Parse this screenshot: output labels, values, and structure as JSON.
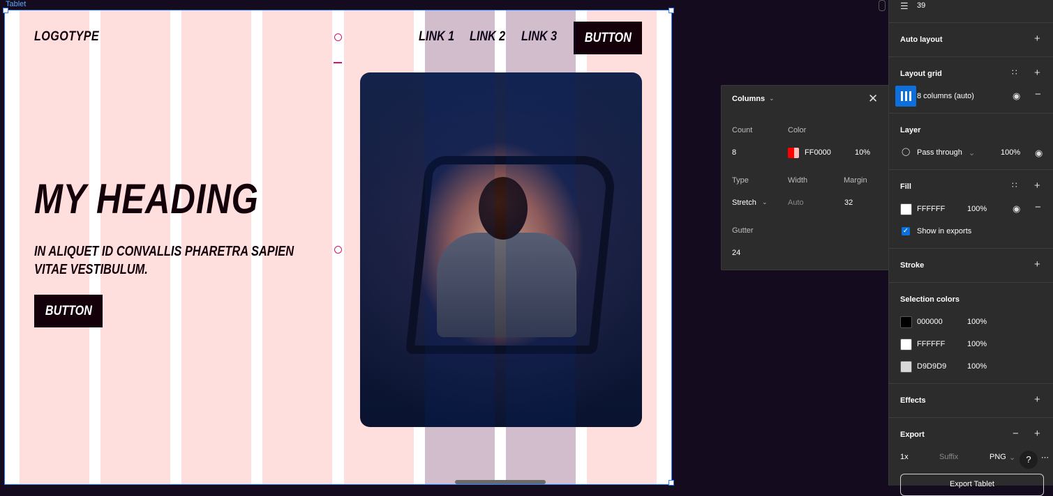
{
  "frame": {
    "label": "Tablet"
  },
  "site": {
    "logo": "LOGOTYPE",
    "links": [
      "LINK 1",
      "LINK 2",
      "LINK 3"
    ],
    "nav_button": "BUTTON",
    "heading": "MY HEADING",
    "subheading": "IN ALIQUET ID CONVALLIS PHARETRA SAPIEN VITAE VESTIBULUM.",
    "cta_button": "BUTTON"
  },
  "columns_popover": {
    "title": "Columns",
    "count_label": "Count",
    "count_value": "8",
    "color_label": "Color",
    "color_hex": "FF0000",
    "color_opacity": "10%",
    "type_label": "Type",
    "type_value": "Stretch",
    "width_label": "Width",
    "width_placeholder": "Auto",
    "margin_label": "Margin",
    "margin_value": "32",
    "gutter_label": "Gutter",
    "gutter_value": "24"
  },
  "panel": {
    "spacing_value": "39",
    "auto_layout": "Auto layout",
    "layout_grid": {
      "title": "Layout grid",
      "item": "8 columns (auto)"
    },
    "layer": {
      "title": "Layer",
      "blend": "Pass through",
      "opacity": "100%"
    },
    "fill": {
      "title": "Fill",
      "hex": "FFFFFF",
      "opacity": "100%",
      "show_in_exports": "Show in exports"
    },
    "stroke": "Stroke",
    "selection_colors": {
      "title": "Selection colors",
      "items": [
        {
          "hex": "000000",
          "opacity": "100%",
          "color": "#000000"
        },
        {
          "hex": "FFFFFF",
          "opacity": "100%",
          "color": "#FFFFFF"
        },
        {
          "hex": "D9D9D9",
          "opacity": "100%",
          "color": "#D9D9D9"
        }
      ]
    },
    "effects": "Effects",
    "export": {
      "title": "Export",
      "scale": "1x",
      "suffix_placeholder": "Suffix",
      "format": "PNG",
      "button": "Export Tablet"
    },
    "help": "?"
  },
  "colors": {
    "accent": "#0d6fdb",
    "grid": "#FF0000",
    "site_dark": "#140008",
    "canvas_bg": "#140b1f"
  }
}
